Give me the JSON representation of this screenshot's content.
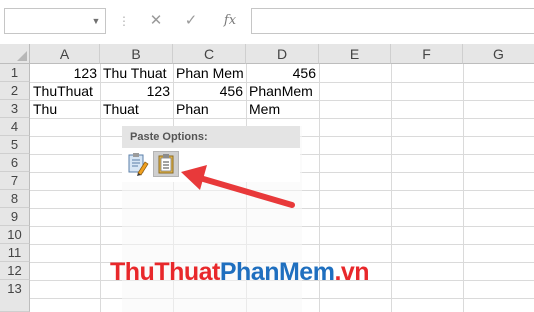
{
  "formula_bar": {
    "name_box": "",
    "cancel_icon": "✕",
    "enter_icon": "✓",
    "fx_label": "fx",
    "formula": ""
  },
  "columns": [
    "A",
    "B",
    "C",
    "D",
    "E",
    "F",
    "G"
  ],
  "rows": [
    "1",
    "2",
    "3",
    "4",
    "5",
    "6",
    "7",
    "8",
    "9",
    "10",
    "11",
    "12",
    "13"
  ],
  "cells": {
    "A1": "123",
    "B1": "Thu Thuat",
    "C1": "Phan Mem",
    "D1": "456",
    "A2": "ThuThuat",
    "B2": "123",
    "C2": "456",
    "D2": "PhanMem",
    "A3": "Thu",
    "B3": "Thuat",
    "C3": "Phan",
    "D3": "Mem"
  },
  "paste_options": {
    "title": "Paste Options:",
    "buttons": [
      "keep-source-formatting-icon",
      "paste-text-only-icon"
    ]
  },
  "annotation": {
    "color": "#e8393a"
  },
  "watermark": {
    "part1": "ThuThuat",
    "part2": "PhanMem",
    "part3": ".vn",
    "color1": "#e8282b",
    "color2": "#1f6fbf"
  }
}
